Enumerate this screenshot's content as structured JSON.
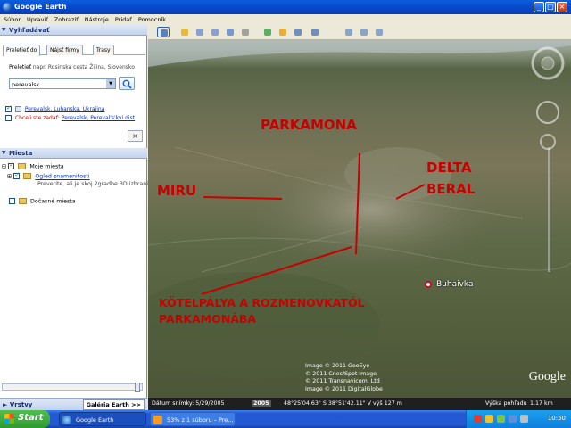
{
  "window": {
    "title": "Google Earth"
  },
  "menu": [
    "Súbor",
    "Upraviť",
    "Zobraziť",
    "Nástroje",
    "Pridať",
    "Pomocník"
  ],
  "search": {
    "header": "Vyhľadávať",
    "tabs": [
      "Preletieť do",
      "Nájsť firmy",
      "Trasy"
    ],
    "hint_label": "Preletieť",
    "hint_text": "napr. Rosinská cesta Žilina, Slovensko",
    "value": "perevalsk",
    "results": [
      {
        "text": "Perevalsk, Luhanska, Ukrajina",
        "checked": true
      },
      {
        "prefix": "Chceli ste zadať:",
        "text": "Perevalsk, Pereval's'kyi dist",
        "checked": false
      }
    ],
    "close_label": "×"
  },
  "places": {
    "header": "Miesta",
    "items": [
      {
        "label": "Moje miesta"
      },
      {
        "label": "Ogled znamenitosti"
      },
      {
        "label": "Preverite, ali je skoj 2gradbe 3D izbrani"
      },
      {
        "label": "Dočasné miesta"
      }
    ]
  },
  "bottom": {
    "layers": "Vrstvy",
    "gallery": "Galéria Earth",
    "gallery_arrow": ">>"
  },
  "map": {
    "annotations": [
      {
        "text": "PARKAMONA"
      },
      {
        "text": "DELTA"
      },
      {
        "text": "BERAL"
      },
      {
        "text": "MIRU"
      },
      {
        "text": "KÖTELPÁLYA A ROZMENOVKATÓL"
      },
      {
        "text": "PARKAMONÁBA"
      }
    ],
    "place_label": "Buhaivka",
    "credits": [
      "Image © 2011 GeoEye",
      "© 2011 Cnes/Spot Image",
      "© 2011 Transnavicom, Ltd",
      "Image © 2011 DigitalGlobe"
    ],
    "logo": "Google",
    "annotation_color": "#c80000"
  },
  "status": {
    "date_label": "Dátum snímky: 5/29/2005",
    "year": "2005",
    "coords": "48°25'04.63\" S   38°51'42.11\" V  výš  127 m",
    "eye_label": "Výška pohľadu",
    "eye_value": "1.17 km"
  },
  "taskbar": {
    "start": "Start",
    "tasks": [
      "Google Earth",
      "53% z 1 súboru – Pre..."
    ],
    "clock": "10:50"
  }
}
